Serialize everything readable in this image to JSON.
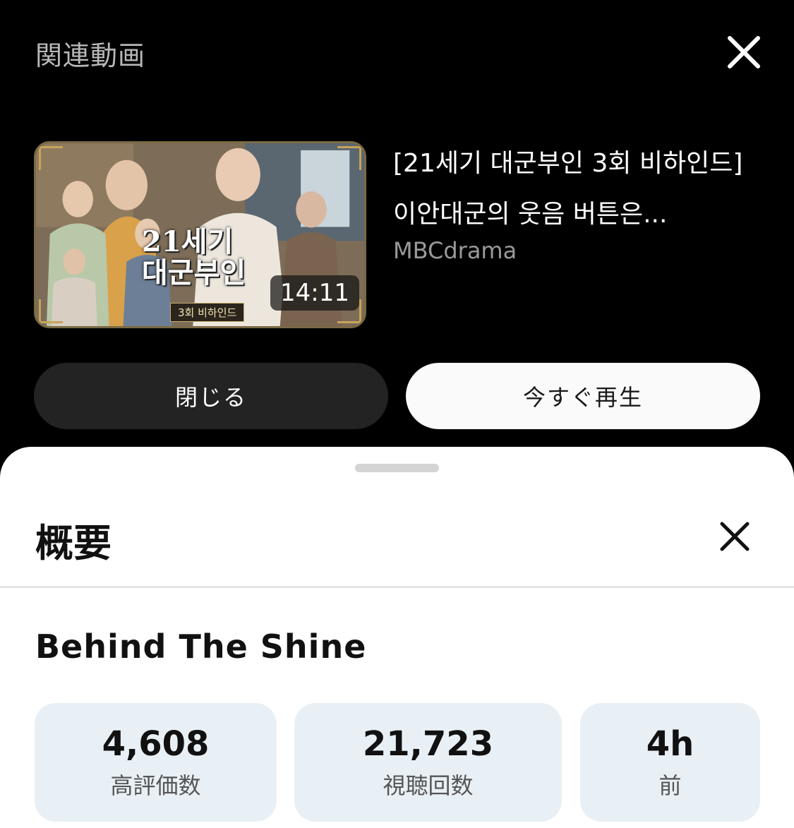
{
  "overlay": {
    "title": "関連動画",
    "close_icon": "close-icon"
  },
  "video": {
    "thumbnail_logo_line1": "21세기",
    "thumbnail_logo_line2": "대군부인",
    "thumbnail_tag": "3회 비하인드",
    "duration": "14:11",
    "title": "[21세기 대군부인 3회 비하인드] 이안대군의 웃음 버튼은...",
    "channel": "MBCdrama"
  },
  "buttons": {
    "close_label": "閉じる",
    "play_now_label": "今すぐ再生"
  },
  "sheet": {
    "title": "概要",
    "description_title": "Behind The Shine",
    "stats": [
      {
        "value": "4,608",
        "label": "高評価数"
      },
      {
        "value": "21,723",
        "label": "視聴回数"
      },
      {
        "value": "4h",
        "label": "前"
      }
    ]
  },
  "colors": {
    "overlay_bg": "#000000",
    "sheet_bg": "#ffffff",
    "stat_bg": "#e8f0f5",
    "play_button_bg": "#fafafa",
    "close_button_bg": "#232323"
  }
}
